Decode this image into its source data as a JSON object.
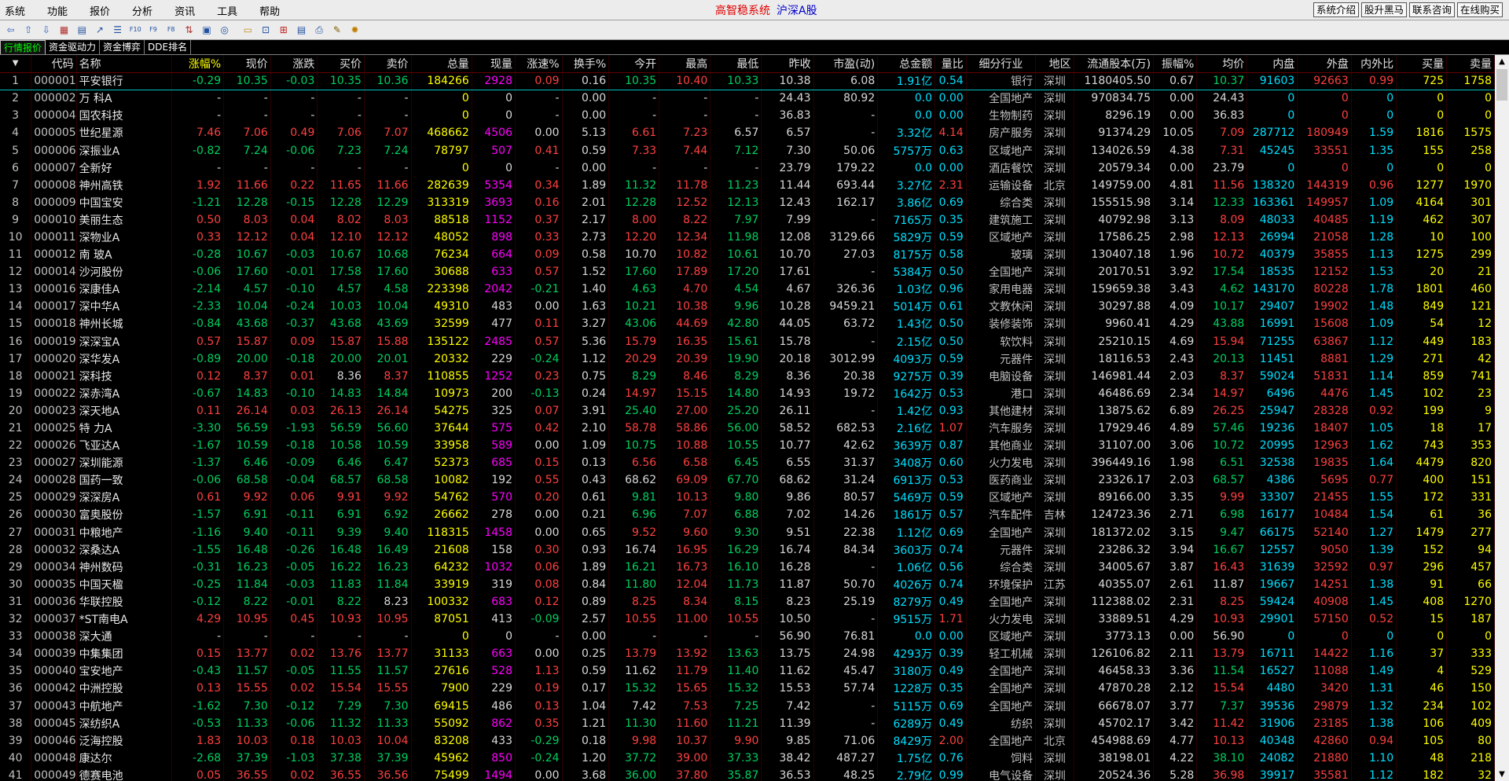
{
  "menu": [
    "系统",
    "功能",
    "报价",
    "分析",
    "资讯",
    "工具",
    "帮助"
  ],
  "title_red": "高智稳系统",
  "title_blue": "沪深A股",
  "right_buttons": [
    "系统介绍",
    "股升黑马",
    "联系咨询",
    "在线购买"
  ],
  "toolbar_icons": [
    "back-icon",
    "up-icon",
    "down-icon",
    "calc-icon",
    "grid-icon",
    "trend-icon",
    "list-icon",
    "f10-icon",
    "f9-icon",
    "f8-icon",
    "funds-icon",
    "graph-icon",
    "circle-icon",
    "folder-icon",
    "expand-icon",
    "chart-icon",
    "news-icon",
    "print-icon",
    "settings-icon",
    "gear-icon"
  ],
  "tabs": [
    "行情报价",
    "资金驱动力",
    "资金博弈",
    "DDE排名"
  ],
  "columns": [
    "",
    "代码",
    "名称",
    "涨幅%",
    "现价",
    "涨跌",
    "买价",
    "卖价",
    "总量",
    "现量",
    "涨速%",
    "换手%",
    "今开",
    "最高",
    "最低",
    "昨收",
    "市盈(动)",
    "总金额",
    "量比",
    "细分行业",
    "地区",
    "流通股本(万)",
    "振幅%",
    "均价",
    "内盘",
    "外盘",
    "内外比",
    "买量",
    "卖量"
  ],
  "rows": [
    [
      "1",
      "000001",
      "平安银行",
      "-0.29",
      "10.35",
      "-0.03",
      "10.35",
      "10.36",
      "184266",
      "2928",
      "0.09",
      "0.16",
      "10.35",
      "10.40",
      "10.33",
      "10.38",
      "6.08",
      "1.91亿",
      "0.54",
      "银行",
      "深圳",
      "1180405.50",
      "0.67",
      "10.37",
      "91603",
      "92663",
      "0.99",
      "725",
      "1758"
    ],
    [
      "2",
      "000002",
      "万 科A",
      "-",
      "-",
      "-",
      "-",
      "-",
      "0",
      "0",
      "-",
      "0.00",
      "-",
      "-",
      "-",
      "24.43",
      "80.92",
      "0.0",
      "0.00",
      "全国地产",
      "深圳",
      "970834.75",
      "0.00",
      "24.43",
      "0",
      "0",
      "0",
      "0",
      "0"
    ],
    [
      "3",
      "000004",
      "国农科技",
      "-",
      "-",
      "-",
      "-",
      "-",
      "0",
      "0",
      "-",
      "0.00",
      "-",
      "-",
      "-",
      "36.83",
      "-",
      "0.0",
      "0.00",
      "生物制药",
      "深圳",
      "8296.19",
      "0.00",
      "36.83",
      "0",
      "0",
      "0",
      "0",
      "0"
    ],
    [
      "4",
      "000005",
      "世纪星源",
      "7.46",
      "7.06",
      "0.49",
      "7.06",
      "7.07",
      "468662",
      "4506",
      "0.00",
      "5.13",
      "6.61",
      "7.23",
      "6.57",
      "6.57",
      "-",
      "3.32亿",
      "4.14",
      "房产服务",
      "深圳",
      "91374.29",
      "10.05",
      "7.09",
      "287712",
      "180949",
      "1.59",
      "1816",
      "1575"
    ],
    [
      "5",
      "000006",
      "深振业A",
      "-0.82",
      "7.24",
      "-0.06",
      "7.23",
      "7.24",
      "78797",
      "507",
      "0.41",
      "0.59",
      "7.33",
      "7.44",
      "7.12",
      "7.30",
      "50.06",
      "5757万",
      "0.63",
      "区域地产",
      "深圳",
      "134026.59",
      "4.38",
      "7.31",
      "45245",
      "33551",
      "1.35",
      "155",
      "258"
    ],
    [
      "6",
      "000007",
      "全新好",
      "-",
      "-",
      "-",
      "-",
      "-",
      "0",
      "0",
      "-",
      "0.00",
      "-",
      "-",
      "-",
      "23.79",
      "179.22",
      "0.0",
      "0.00",
      "酒店餐饮",
      "深圳",
      "20579.34",
      "0.00",
      "23.79",
      "0",
      "0",
      "0",
      "0",
      "0"
    ],
    [
      "7",
      "000008",
      "神州高铁",
      "1.92",
      "11.66",
      "0.22",
      "11.65",
      "11.66",
      "282639",
      "5354",
      "0.34",
      "1.89",
      "11.32",
      "11.78",
      "11.23",
      "11.44",
      "693.44",
      "3.27亿",
      "2.31",
      "运输设备",
      "北京",
      "149759.00",
      "4.81",
      "11.56",
      "138320",
      "144319",
      "0.96",
      "1277",
      "1970"
    ],
    [
      "8",
      "000009",
      "中国宝安",
      "-1.21",
      "12.28",
      "-0.15",
      "12.28",
      "12.29",
      "313319",
      "3693",
      "0.16",
      "2.01",
      "12.28",
      "12.52",
      "12.13",
      "12.43",
      "162.17",
      "3.86亿",
      "0.69",
      "综合类",
      "深圳",
      "155515.98",
      "3.14",
      "12.33",
      "163361",
      "149957",
      "1.09",
      "4164",
      "301"
    ],
    [
      "9",
      "000010",
      "美丽生态",
      "0.50",
      "8.03",
      "0.04",
      "8.02",
      "8.03",
      "88518",
      "1152",
      "0.37",
      "2.17",
      "8.00",
      "8.22",
      "7.97",
      "7.99",
      "-",
      "7165万",
      "0.35",
      "建筑施工",
      "深圳",
      "40792.98",
      "3.13",
      "8.09",
      "48033",
      "40485",
      "1.19",
      "462",
      "307"
    ],
    [
      "10",
      "000011",
      "深物业A",
      "0.33",
      "12.12",
      "0.04",
      "12.10",
      "12.12",
      "48052",
      "898",
      "0.33",
      "2.73",
      "12.20",
      "12.34",
      "11.98",
      "12.08",
      "3129.66",
      "5829万",
      "0.59",
      "区域地产",
      "深圳",
      "17586.25",
      "2.98",
      "12.13",
      "26994",
      "21058",
      "1.28",
      "10",
      "100"
    ],
    [
      "11",
      "000012",
      "南 玻A",
      "-0.28",
      "10.67",
      "-0.03",
      "10.67",
      "10.68",
      "76234",
      "664",
      "0.09",
      "0.58",
      "10.70",
      "10.82",
      "10.61",
      "10.70",
      "27.03",
      "8175万",
      "0.58",
      "玻璃",
      "深圳",
      "130407.18",
      "1.96",
      "10.72",
      "40379",
      "35855",
      "1.13",
      "1275",
      "299"
    ],
    [
      "12",
      "000014",
      "沙河股份",
      "-0.06",
      "17.60",
      "-0.01",
      "17.58",
      "17.60",
      "30688",
      "633",
      "0.57",
      "1.52",
      "17.60",
      "17.89",
      "17.20",
      "17.61",
      "-",
      "5384万",
      "0.50",
      "全国地产",
      "深圳",
      "20170.51",
      "3.92",
      "17.54",
      "18535",
      "12152",
      "1.53",
      "20",
      "21"
    ],
    [
      "13",
      "000016",
      "深康佳A",
      "-2.14",
      "4.57",
      "-0.10",
      "4.57",
      "4.58",
      "223398",
      "2042",
      "-0.21",
      "1.40",
      "4.63",
      "4.70",
      "4.54",
      "4.67",
      "326.36",
      "1.03亿",
      "0.96",
      "家用电器",
      "深圳",
      "159659.38",
      "3.43",
      "4.62",
      "143170",
      "80228",
      "1.78",
      "1801",
      "460"
    ],
    [
      "14",
      "000017",
      "深中华A",
      "-2.33",
      "10.04",
      "-0.24",
      "10.03",
      "10.04",
      "49310",
      "483",
      "0.00",
      "1.63",
      "10.21",
      "10.38",
      "9.96",
      "10.28",
      "9459.21",
      "5014万",
      "0.61",
      "文教休闲",
      "深圳",
      "30297.88",
      "4.09",
      "10.17",
      "29407",
      "19902",
      "1.48",
      "849",
      "121"
    ],
    [
      "15",
      "000018",
      "神州长城",
      "-0.84",
      "43.68",
      "-0.37",
      "43.68",
      "43.69",
      "32599",
      "477",
      "0.11",
      "3.27",
      "43.06",
      "44.69",
      "42.80",
      "44.05",
      "63.72",
      "1.43亿",
      "0.50",
      "装修装饰",
      "深圳",
      "9960.41",
      "4.29",
      "43.88",
      "16991",
      "15608",
      "1.09",
      "54",
      "12"
    ],
    [
      "16",
      "000019",
      "深深宝A",
      "0.57",
      "15.87",
      "0.09",
      "15.87",
      "15.88",
      "135122",
      "2485",
      "0.57",
      "5.36",
      "15.79",
      "16.35",
      "15.61",
      "15.78",
      "-",
      "2.15亿",
      "0.50",
      "软饮料",
      "深圳",
      "25210.15",
      "4.69",
      "15.94",
      "71255",
      "63867",
      "1.12",
      "449",
      "183"
    ],
    [
      "17",
      "000020",
      "深华发A",
      "-0.89",
      "20.00",
      "-0.18",
      "20.00",
      "20.01",
      "20332",
      "229",
      "-0.24",
      "1.12",
      "20.29",
      "20.39",
      "19.90",
      "20.18",
      "3012.99",
      "4093万",
      "0.59",
      "元器件",
      "深圳",
      "18116.53",
      "2.43",
      "20.13",
      "11451",
      "8881",
      "1.29",
      "271",
      "42"
    ],
    [
      "18",
      "000021",
      "深科技",
      "0.12",
      "8.37",
      "0.01",
      "8.36",
      "8.37",
      "110855",
      "1252",
      "0.23",
      "0.75",
      "8.29",
      "8.46",
      "8.29",
      "8.36",
      "20.38",
      "9275万",
      "0.39",
      "电脑设备",
      "深圳",
      "146981.44",
      "2.03",
      "8.37",
      "59024",
      "51831",
      "1.14",
      "859",
      "741"
    ],
    [
      "19",
      "000022",
      "深赤湾A",
      "-0.67",
      "14.83",
      "-0.10",
      "14.83",
      "14.84",
      "10973",
      "200",
      "-0.13",
      "0.24",
      "14.97",
      "15.15",
      "14.80",
      "14.93",
      "19.72",
      "1642万",
      "0.53",
      "港口",
      "深圳",
      "46486.69",
      "2.34",
      "14.97",
      "6496",
      "4476",
      "1.45",
      "102",
      "23"
    ],
    [
      "20",
      "000023",
      "深天地A",
      "0.11",
      "26.14",
      "0.03",
      "26.13",
      "26.14",
      "54275",
      "325",
      "0.07",
      "3.91",
      "25.40",
      "27.00",
      "25.20",
      "26.11",
      "-",
      "1.42亿",
      "0.93",
      "其他建材",
      "深圳",
      "13875.62",
      "6.89",
      "26.25",
      "25947",
      "28328",
      "0.92",
      "199",
      "9"
    ],
    [
      "21",
      "000025",
      "特 力A",
      "-3.30",
      "56.59",
      "-1.93",
      "56.59",
      "56.60",
      "37644",
      "575",
      "0.42",
      "2.10",
      "58.78",
      "58.86",
      "56.00",
      "58.52",
      "682.53",
      "2.16亿",
      "1.07",
      "汽车服务",
      "深圳",
      "17929.46",
      "4.89",
      "57.46",
      "19236",
      "18407",
      "1.05",
      "18",
      "17"
    ],
    [
      "22",
      "000026",
      "飞亚达A",
      "-1.67",
      "10.59",
      "-0.18",
      "10.58",
      "10.59",
      "33958",
      "589",
      "0.00",
      "1.09",
      "10.75",
      "10.88",
      "10.55",
      "10.77",
      "42.62",
      "3639万",
      "0.87",
      "其他商业",
      "深圳",
      "31107.00",
      "3.06",
      "10.72",
      "20995",
      "12963",
      "1.62",
      "743",
      "353"
    ],
    [
      "23",
      "000027",
      "深圳能源",
      "-1.37",
      "6.46",
      "-0.09",
      "6.46",
      "6.47",
      "52373",
      "685",
      "0.15",
      "0.13",
      "6.56",
      "6.58",
      "6.45",
      "6.55",
      "31.37",
      "3408万",
      "0.60",
      "火力发电",
      "深圳",
      "396449.16",
      "1.98",
      "6.51",
      "32538",
      "19835",
      "1.64",
      "4479",
      "820"
    ],
    [
      "24",
      "000028",
      "国药一致",
      "-0.06",
      "68.58",
      "-0.04",
      "68.57",
      "68.58",
      "10082",
      "192",
      "0.55",
      "0.43",
      "68.62",
      "69.09",
      "67.70",
      "68.62",
      "31.24",
      "6913万",
      "0.53",
      "医药商业",
      "深圳",
      "23326.17",
      "2.03",
      "68.57",
      "4386",
      "5695",
      "0.77",
      "400",
      "151"
    ],
    [
      "25",
      "000029",
      "深深房A",
      "0.61",
      "9.92",
      "0.06",
      "9.91",
      "9.92",
      "54762",
      "570",
      "0.20",
      "0.61",
      "9.81",
      "10.13",
      "9.80",
      "9.86",
      "80.57",
      "5469万",
      "0.59",
      "区域地产",
      "深圳",
      "89166.00",
      "3.35",
      "9.99",
      "33307",
      "21455",
      "1.55",
      "172",
      "331"
    ],
    [
      "26",
      "000030",
      "富奥股份",
      "-1.57",
      "6.91",
      "-0.11",
      "6.91",
      "6.92",
      "26662",
      "278",
      "0.00",
      "0.21",
      "6.96",
      "7.07",
      "6.88",
      "7.02",
      "14.26",
      "1861万",
      "0.57",
      "汽车配件",
      "吉林",
      "124723.36",
      "2.71",
      "6.98",
      "16177",
      "10484",
      "1.54",
      "61",
      "36"
    ],
    [
      "27",
      "000031",
      "中粮地产",
      "-1.16",
      "9.40",
      "-0.11",
      "9.39",
      "9.40",
      "118315",
      "1458",
      "0.00",
      "0.65",
      "9.52",
      "9.60",
      "9.30",
      "9.51",
      "22.38",
      "1.12亿",
      "0.69",
      "全国地产",
      "深圳",
      "181372.02",
      "3.15",
      "9.47",
      "66175",
      "52140",
      "1.27",
      "1479",
      "277"
    ],
    [
      "28",
      "000032",
      "深桑达A",
      "-1.55",
      "16.48",
      "-0.26",
      "16.48",
      "16.49",
      "21608",
      "158",
      "0.30",
      "0.93",
      "16.74",
      "16.95",
      "16.29",
      "16.74",
      "84.34",
      "3603万",
      "0.74",
      "元器件",
      "深圳",
      "23286.32",
      "3.94",
      "16.67",
      "12557",
      "9050",
      "1.39",
      "152",
      "94"
    ],
    [
      "29",
      "000034",
      "神州数码",
      "-0.31",
      "16.23",
      "-0.05",
      "16.22",
      "16.23",
      "64232",
      "1032",
      "0.06",
      "1.89",
      "16.21",
      "16.73",
      "16.10",
      "16.28",
      "-",
      "1.06亿",
      "0.56",
      "综合类",
      "深圳",
      "34005.67",
      "3.87",
      "16.43",
      "31639",
      "32592",
      "0.97",
      "296",
      "457"
    ],
    [
      "30",
      "000035",
      "中国天楹",
      "-0.25",
      "11.84",
      "-0.03",
      "11.83",
      "11.84",
      "33919",
      "319",
      "0.08",
      "0.84",
      "11.80",
      "12.04",
      "11.73",
      "11.87",
      "50.70",
      "4026万",
      "0.74",
      "环境保护",
      "江苏",
      "40355.07",
      "2.61",
      "11.87",
      "19667",
      "14251",
      "1.38",
      "91",
      "66"
    ],
    [
      "31",
      "000036",
      "华联控股",
      "-0.12",
      "8.22",
      "-0.01",
      "8.22",
      "8.23",
      "100332",
      "683",
      "0.12",
      "0.89",
      "8.25",
      "8.34",
      "8.15",
      "8.23",
      "25.19",
      "8279万",
      "0.49",
      "全国地产",
      "深圳",
      "112388.02",
      "2.31",
      "8.25",
      "59424",
      "40908",
      "1.45",
      "408",
      "1270"
    ],
    [
      "32",
      "000037",
      "*ST南电A",
      "4.29",
      "10.95",
      "0.45",
      "10.93",
      "10.95",
      "87051",
      "413",
      "-0.09",
      "2.57",
      "10.55",
      "11.00",
      "10.55",
      "10.50",
      "-",
      "9515万",
      "1.71",
      "火力发电",
      "深圳",
      "33889.51",
      "4.29",
      "10.93",
      "29901",
      "57150",
      "0.52",
      "15",
      "187"
    ],
    [
      "33",
      "000038",
      "深大通",
      "-",
      "-",
      "-",
      "-",
      "-",
      "0",
      "0",
      "-",
      "0.00",
      "-",
      "-",
      "-",
      "56.90",
      "76.81",
      "0.0",
      "0.00",
      "区域地产",
      "深圳",
      "3773.13",
      "0.00",
      "56.90",
      "0",
      "0",
      "0",
      "0",
      "0"
    ],
    [
      "34",
      "000039",
      "中集集团",
      "0.15",
      "13.77",
      "0.02",
      "13.76",
      "13.77",
      "31133",
      "663",
      "0.00",
      "0.25",
      "13.79",
      "13.92",
      "13.63",
      "13.75",
      "24.98",
      "4293万",
      "0.39",
      "轻工机械",
      "深圳",
      "126106.82",
      "2.11",
      "13.79",
      "16711",
      "14422",
      "1.16",
      "37",
      "333"
    ],
    [
      "35",
      "000040",
      "宝安地产",
      "-0.43",
      "11.57",
      "-0.05",
      "11.55",
      "11.57",
      "27616",
      "528",
      "1.13",
      "0.59",
      "11.62",
      "11.79",
      "11.40",
      "11.62",
      "45.47",
      "3180万",
      "0.49",
      "全国地产",
      "深圳",
      "46458.33",
      "3.36",
      "11.54",
      "16527",
      "11088",
      "1.49",
      "4",
      "529"
    ],
    [
      "36",
      "000042",
      "中洲控股",
      "0.13",
      "15.55",
      "0.02",
      "15.54",
      "15.55",
      "7900",
      "229",
      "0.19",
      "0.17",
      "15.32",
      "15.65",
      "15.32",
      "15.53",
      "57.74",
      "1228万",
      "0.35",
      "全国地产",
      "深圳",
      "47870.28",
      "2.12",
      "15.54",
      "4480",
      "3420",
      "1.31",
      "46",
      "150"
    ],
    [
      "37",
      "000043",
      "中航地产",
      "-1.62",
      "7.30",
      "-0.12",
      "7.29",
      "7.30",
      "69415",
      "486",
      "0.13",
      "1.04",
      "7.42",
      "7.53",
      "7.25",
      "7.42",
      "-",
      "5115万",
      "0.69",
      "全国地产",
      "深圳",
      "66678.07",
      "3.77",
      "7.37",
      "39536",
      "29879",
      "1.32",
      "234",
      "102"
    ],
    [
      "38",
      "000045",
      "深纺织A",
      "-0.53",
      "11.33",
      "-0.06",
      "11.32",
      "11.33",
      "55092",
      "862",
      "0.35",
      "1.21",
      "11.30",
      "11.60",
      "11.21",
      "11.39",
      "-",
      "6289万",
      "0.49",
      "纺织",
      "深圳",
      "45702.17",
      "3.42",
      "11.42",
      "31906",
      "23185",
      "1.38",
      "106",
      "409"
    ],
    [
      "39",
      "000046",
      "泛海控股",
      "1.83",
      "10.03",
      "0.18",
      "10.03",
      "10.04",
      "83208",
      "433",
      "-0.29",
      "0.18",
      "9.98",
      "10.37",
      "9.90",
      "9.85",
      "71.06",
      "8429万",
      "2.00",
      "全国地产",
      "北京",
      "454988.69",
      "4.77",
      "10.13",
      "40348",
      "42860",
      "0.94",
      "105",
      "80"
    ],
    [
      "40",
      "000048",
      "康达尔",
      "-2.68",
      "37.39",
      "-1.03",
      "37.38",
      "37.39",
      "45962",
      "850",
      "-0.24",
      "1.20",
      "37.72",
      "39.00",
      "37.33",
      "38.42",
      "487.27",
      "1.75亿",
      "0.76",
      "饲料",
      "深圳",
      "38198.01",
      "4.22",
      "38.10",
      "24082",
      "21880",
      "1.10",
      "48",
      "218"
    ],
    [
      "41",
      "000049",
      "德赛电池",
      "0.05",
      "36.55",
      "0.02",
      "36.55",
      "36.56",
      "75499",
      "1494",
      "0.00",
      "3.68",
      "36.00",
      "37.80",
      "35.87",
      "36.53",
      "48.25",
      "2.79亿",
      "0.99",
      "电气设备",
      "深圳",
      "20524.36",
      "5.28",
      "36.98",
      "39917",
      "35581",
      "1.12",
      "182",
      "32"
    ]
  ]
}
